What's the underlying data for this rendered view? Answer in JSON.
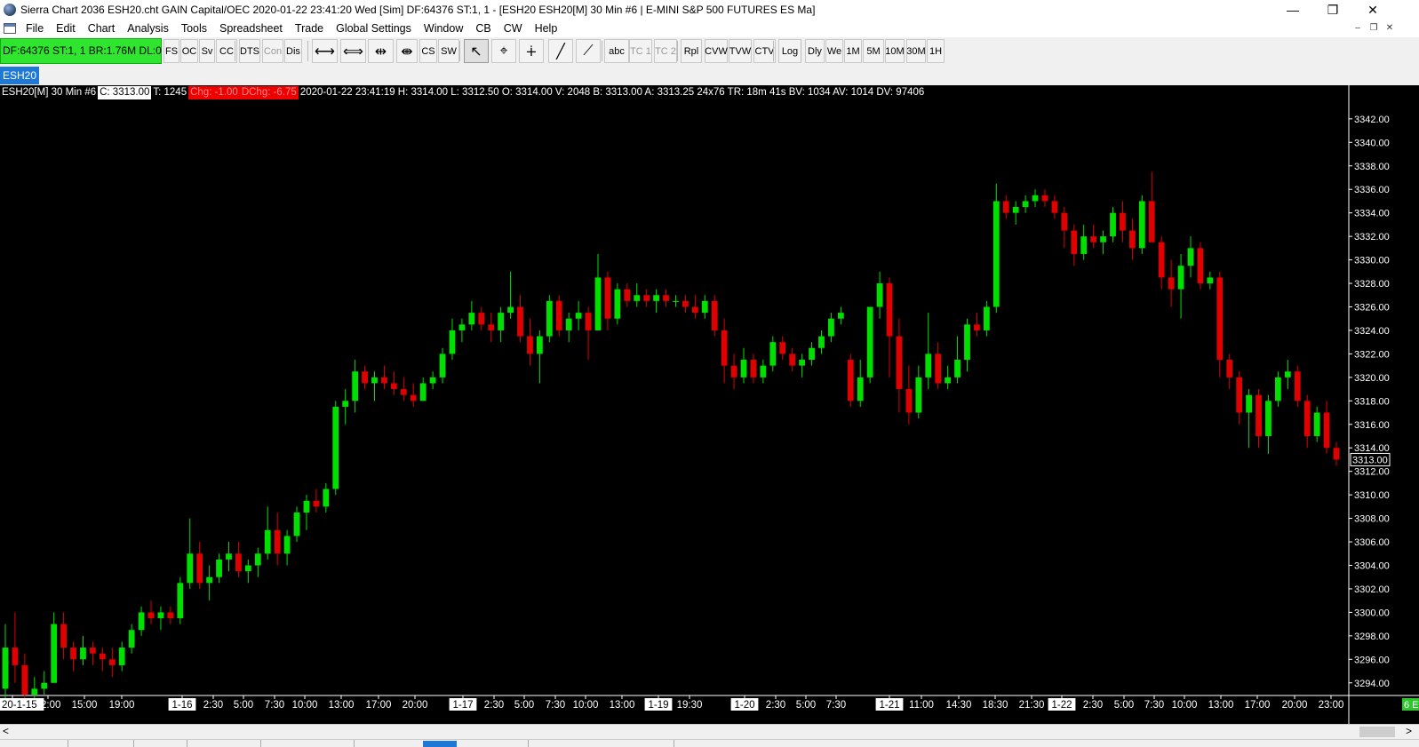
{
  "window": {
    "title": "Sierra Chart 2036 ESH20.cht  GAIN Capital/OEC 2020-01-22  23:41:20 Wed [Sim]  DF:64376  ST:1, 1 - [ESH20  ESH20[M]  30 Min   #6 | E-MINI S&P 500 FUTURES ES Ma]",
    "minimize": "—",
    "maximize": "❐",
    "close": "✕",
    "mdi_minimize": "–",
    "mdi_restore": "❐",
    "mdi_close": "✕"
  },
  "menu": [
    "File",
    "Edit",
    "Chart",
    "Analysis",
    "Tools",
    "Spreadsheet",
    "Trade",
    "Global Settings",
    "Window",
    "CB",
    "CW",
    "Help"
  ],
  "toolbar": {
    "status": "DF:64376  ST:1, 1   BR:1.76M  DL:0",
    "buttons": [
      "FS",
      "OC",
      "Sv",
      "CC",
      "DTS",
      "Con",
      "Dis",
      "⟷",
      "⟺",
      "⇹",
      "⇼",
      "CS",
      "SW",
      "↖",
      "⌖",
      "∔",
      "╱",
      "⟋",
      "abc",
      "TC 1",
      "TC 2",
      "Rpl",
      "CVW",
      "TVW",
      "CTV",
      "Log",
      "Dly",
      "We",
      "1M",
      "5M",
      "10M",
      "30M",
      "1H"
    ],
    "colors": {
      "status_bg": "#2fe52f"
    }
  },
  "tab": {
    "label": "ESH20"
  },
  "chart": {
    "info": {
      "symbol": "ESH20[M]  30 Min   #6",
      "close": "C: 3313.00",
      "trades": "T: 1245",
      "chg": "Chg: -1.00",
      "dchg": "DChg: -6.75",
      "rest": "2020-01-22 23:41:19 H: 3314.00 L: 3312.50 O: 3314.00 V: 2048 B: 3313.00 A: 3313.25 24x76 TR: 18m 41s BV: 1034 AV: 1014 DV: 97406"
    },
    "colors": {
      "up": "#00e000",
      "down": "#e00000",
      "background": "#000000",
      "axis_text": "#ffffff"
    },
    "price_labels": [
      "3342.00",
      "3340.00",
      "3338.00",
      "3336.00",
      "3334.00",
      "3332.00",
      "3330.00",
      "3328.00",
      "3326.00",
      "3324.00",
      "3322.00",
      "3320.00",
      "3318.00",
      "3316.00",
      "3314.00",
      "3312.00",
      "3310.00",
      "3308.00",
      "3306.00",
      "3304.00",
      "3302.00",
      "3300.00",
      "3298.00",
      "3296.00",
      "3294.00"
    ],
    "current_price": "3313.00",
    "corner_badge": "6 E",
    "time_labels": [
      {
        "t": "20-1-15",
        "box": true
      },
      {
        "t": "12:00"
      },
      {
        "t": "15:00"
      },
      {
        "t": "19:00"
      },
      {
        "t": "1-16",
        "box": true
      },
      {
        "t": "2:30"
      },
      {
        "t": "5:00"
      },
      {
        "t": "7:30"
      },
      {
        "t": "10:00"
      },
      {
        "t": "13:00"
      },
      {
        "t": "17:00"
      },
      {
        "t": "20:00"
      },
      {
        "t": "1-17",
        "box": true
      },
      {
        "t": "2:30"
      },
      {
        "t": "5:00"
      },
      {
        "t": "7:30"
      },
      {
        "t": "10:00"
      },
      {
        "t": "13:00"
      },
      {
        "t": "1-19",
        "box": true
      },
      {
        "t": "19:30"
      },
      {
        "t": "1-20",
        "box": true
      },
      {
        "t": "2:30"
      },
      {
        "t": "5:00"
      },
      {
        "t": "7:30"
      },
      {
        "t": "1-21",
        "box": true
      },
      {
        "t": "11:00"
      },
      {
        "t": "14:30"
      },
      {
        "t": "18:30"
      },
      {
        "t": "21:30"
      },
      {
        "t": "1-22",
        "box": true
      },
      {
        "t": "2:30"
      },
      {
        "t": "5:00"
      },
      {
        "t": "7:30"
      },
      {
        "t": "10:00"
      },
      {
        "t": "13:00"
      },
      {
        "t": "17:00"
      },
      {
        "t": "20:00"
      },
      {
        "t": "23:00"
      }
    ],
    "scroll_left": "<",
    "scroll_right": ">"
  },
  "chart_data": {
    "type": "candlestick",
    "ylim": [
      3293,
      3343.5
    ],
    "series": [
      {
        "ohlc": [
          [
            3293.5,
            3299.0,
            3292.5,
            3297.0
          ],
          [
            3297.0,
            3300.0,
            3294.0,
            3295.5
          ],
          [
            3295.5,
            3296.5,
            3292.0,
            3293.0
          ],
          [
            3293.0,
            3294.5,
            3292.0,
            3293.5
          ],
          [
            3293.5,
            3295.0,
            3293.0,
            3294.0
          ],
          [
            3294.0,
            3300.0,
            3294.0,
            3299.0
          ],
          [
            3299.0,
            3300.0,
            3296.0,
            3297.0
          ],
          [
            3297.0,
            3297.5,
            3295.0,
            3296.0
          ],
          [
            3296.0,
            3298.0,
            3295.5,
            3297.0
          ],
          [
            3297.0,
            3297.5,
            3295.5,
            3296.5
          ],
          [
            3296.5,
            3297.0,
            3295.0,
            3296.0
          ],
          [
            3296.0,
            3297.0,
            3294.5,
            3295.5
          ],
          [
            3295.5,
            3297.5,
            3295.0,
            3297.0
          ],
          [
            3297.0,
            3299.0,
            3296.5,
            3298.5
          ],
          [
            3298.5,
            3300.5,
            3298.0,
            3300.0
          ],
          [
            3300.0,
            3301.0,
            3299.0,
            3299.5
          ],
          [
            3299.5,
            3300.5,
            3298.5,
            3300.0
          ],
          [
            3300.0,
            3300.5,
            3299.0,
            3299.5
          ],
          [
            3299.5,
            3303.0,
            3299.0,
            3302.5
          ],
          [
            3302.5,
            3308.0,
            3302.0,
            3305.0
          ],
          [
            3305.0,
            3306.0,
            3302.0,
            3302.5
          ],
          [
            3302.5,
            3304.0,
            3301.0,
            3303.0
          ],
          [
            3303.0,
            3305.0,
            3302.5,
            3304.5
          ],
          [
            3304.5,
            3306.0,
            3303.5,
            3305.0
          ],
          [
            3305.0,
            3306.0,
            3303.0,
            3303.5
          ],
          [
            3303.5,
            3304.5,
            3302.5,
            3304.0
          ],
          [
            3304.0,
            3305.5,
            3303.0,
            3305.0
          ],
          [
            3305.0,
            3309.0,
            3304.5,
            3307.0
          ],
          [
            3307.0,
            3308.5,
            3304.0,
            3305.0
          ],
          [
            3305.0,
            3307.0,
            3304.0,
            3306.5
          ],
          [
            3306.5,
            3309.0,
            3306.0,
            3308.5
          ],
          [
            3308.5,
            3310.0,
            3307.0,
            3309.5
          ],
          [
            3309.5,
            3310.5,
            3308.5,
            3309.0
          ],
          [
            3309.0,
            3311.0,
            3308.5,
            3310.5
          ],
          [
            3310.5,
            3318.0,
            3310.0,
            3317.5
          ],
          [
            3317.5,
            3319.0,
            3316.0,
            3318.0
          ],
          [
            3318.0,
            3321.5,
            3317.0,
            3320.5
          ],
          [
            3320.5,
            3321.0,
            3319.0,
            3319.5
          ],
          [
            3319.5,
            3320.5,
            3318.0,
            3320.0
          ],
          [
            3320.0,
            3321.0,
            3319.0,
            3319.5
          ],
          [
            3319.5,
            3320.5,
            3318.5,
            3319.0
          ],
          [
            3319.0,
            3320.0,
            3318.0,
            3318.5
          ],
          [
            3318.5,
            3319.5,
            3317.5,
            3318.0
          ],
          [
            3318.0,
            3320.0,
            3318.0,
            3319.5
          ],
          [
            3319.5,
            3320.5,
            3319.0,
            3320.0
          ],
          [
            3320.0,
            3322.5,
            3319.5,
            3322.0
          ],
          [
            3322.0,
            3325.0,
            3321.5,
            3324.0
          ],
          [
            3324.0,
            3325.0,
            3323.0,
            3324.5
          ],
          [
            3324.5,
            3326.5,
            3324.0,
            3325.5
          ],
          [
            3325.5,
            3326.0,
            3324.0,
            3324.5
          ],
          [
            3324.5,
            3325.5,
            3323.0,
            3324.0
          ],
          [
            3324.0,
            3326.0,
            3323.0,
            3325.5
          ],
          [
            3325.5,
            3329.0,
            3325.0,
            3326.0
          ],
          [
            3326.0,
            3327.0,
            3323.0,
            3323.5
          ],
          [
            3323.5,
            3325.0,
            3321.0,
            3322.0
          ],
          [
            3322.0,
            3324.0,
            3319.5,
            3323.5
          ],
          [
            3323.5,
            3327.0,
            3323.0,
            3326.5
          ],
          [
            3326.5,
            3327.0,
            3323.5,
            3324.0
          ],
          [
            3324.0,
            3325.5,
            3323.0,
            3325.0
          ],
          [
            3325.0,
            3326.5,
            3324.0,
            3325.5
          ],
          [
            3325.5,
            3326.0,
            3321.5,
            3324.0
          ],
          [
            3324.0,
            3330.5,
            3324.0,
            3328.5
          ],
          [
            3328.5,
            3329.0,
            3324.0,
            3325.0
          ],
          [
            3325.0,
            3328.0,
            3324.5,
            3327.5
          ],
          [
            3327.5,
            3328.0,
            3326.0,
            3326.5
          ],
          [
            3326.5,
            3328.0,
            3326.0,
            3327.0
          ],
          [
            3327.0,
            3327.5,
            3326.0,
            3326.5
          ],
          [
            3326.5,
            3327.5,
            3325.5,
            3327.0
          ],
          [
            3327.0,
            3327.5,
            3326.0,
            3326.5
          ],
          [
            3326.5,
            3327.0,
            3326.0,
            3326.5
          ],
          [
            3326.5,
            3327.0,
            3325.5,
            3326.0
          ],
          [
            3326.0,
            3327.0,
            3325.0,
            3325.5
          ],
          [
            3325.5,
            3327.0,
            3325.0,
            3326.5
          ],
          [
            3326.5,
            3327.0,
            3323.5,
            3324.0
          ],
          [
            3324.0,
            3325.0,
            3319.5,
            3321.0
          ],
          [
            3321.0,
            3322.0,
            3319.0,
            3320.0
          ],
          [
            3320.0,
            3322.5,
            3319.5,
            3321.5
          ],
          [
            3321.5,
            3322.0,
            3319.5,
            3320.0
          ],
          [
            3320.0,
            3321.5,
            3319.5,
            3321.0
          ],
          [
            3321.0,
            3323.5,
            3320.5,
            3323.0
          ],
          [
            3323.0,
            3323.5,
            3321.5,
            3322.0
          ],
          [
            3322.0,
            3322.5,
            3320.5,
            3321.0
          ],
          [
            3321.0,
            3322.0,
            3320.0,
            3321.5
          ],
          [
            3321.5,
            3323.0,
            3321.0,
            3322.5
          ],
          [
            3322.5,
            3324.0,
            3322.0,
            3323.5
          ],
          [
            3323.5,
            3325.5,
            3323.0,
            3325.0
          ],
          [
            3325.0,
            3326.0,
            3324.5,
            3325.5
          ],
          [
            3321.5,
            3322.0,
            3317.5,
            3318.0
          ],
          [
            3318.0,
            3321.5,
            3317.5,
            3320.0
          ],
          [
            3320.0,
            3325.5,
            3319.5,
            3326.0
          ],
          [
            3326.0,
            3329.0,
            3325.0,
            3328.0
          ],
          [
            3328.0,
            3328.5,
            3320.0,
            3323.5
          ],
          [
            3323.5,
            3325.0,
            3317.0,
            3319.0
          ],
          [
            3319.0,
            3321.0,
            3316.0,
            3317.0
          ],
          [
            3317.0,
            3321.0,
            3316.5,
            3320.0
          ],
          [
            3320.0,
            3325.5,
            3319.0,
            3322.0
          ],
          [
            3322.0,
            3323.0,
            3319.0,
            3319.5
          ],
          [
            3319.5,
            3321.0,
            3319.0,
            3320.0
          ],
          [
            3320.0,
            3323.5,
            3319.5,
            3321.5
          ],
          [
            3321.5,
            3325.0,
            3320.5,
            3324.5
          ],
          [
            3324.5,
            3325.5,
            3323.5,
            3324.0
          ],
          [
            3324.0,
            3326.5,
            3323.5,
            3326.0
          ],
          [
            3326.0,
            3336.5,
            3325.5,
            3335.0
          ],
          [
            3335.0,
            3335.5,
            3333.5,
            3334.0
          ],
          [
            3334.0,
            3335.0,
            3333.0,
            3334.5
          ],
          [
            3334.5,
            3335.5,
            3334.0,
            3335.0
          ],
          [
            3335.0,
            3336.0,
            3334.5,
            3335.5
          ],
          [
            3335.5,
            3336.0,
            3334.5,
            3335.0
          ],
          [
            3335.0,
            3335.5,
            3333.5,
            3334.0
          ],
          [
            3334.0,
            3334.5,
            3331.0,
            3332.5
          ],
          [
            3332.5,
            3333.0,
            3329.5,
            3330.5
          ],
          [
            3330.5,
            3333.0,
            3330.0,
            3332.0
          ],
          [
            3332.0,
            3333.0,
            3331.0,
            3331.5
          ],
          [
            3331.5,
            3332.5,
            3330.5,
            3332.0
          ],
          [
            3332.0,
            3334.5,
            3331.5,
            3334.0
          ],
          [
            3334.0,
            3335.0,
            3331.5,
            3332.5
          ],
          [
            3332.5,
            3333.5,
            3330.0,
            3331.0
          ],
          [
            3331.0,
            3335.5,
            3330.5,
            3335.0
          ],
          [
            3335.0,
            3337.5,
            3333.0,
            3331.5
          ],
          [
            3331.5,
            3332.0,
            3327.5,
            3328.5
          ],
          [
            3328.5,
            3330.0,
            3326.0,
            3327.5
          ],
          [
            3327.5,
            3330.5,
            3325.0,
            3329.5
          ],
          [
            3329.5,
            3332.0,
            3328.5,
            3331.0
          ],
          [
            3331.0,
            3331.5,
            3327.5,
            3328.0
          ],
          [
            3328.0,
            3329.0,
            3327.5,
            3328.5
          ],
          [
            3328.5,
            3329.0,
            3320.0,
            3321.5
          ],
          [
            3321.5,
            3322.0,
            3319.0,
            3320.0
          ],
          [
            3320.0,
            3320.5,
            3316.0,
            3317.0
          ],
          [
            3317.0,
            3319.0,
            3314.0,
            3318.5
          ],
          [
            3318.5,
            3319.0,
            3314.0,
            3315.0
          ],
          [
            3315.0,
            3318.5,
            3313.5,
            3318.0
          ],
          [
            3318.0,
            3320.5,
            3317.5,
            3320.0
          ],
          [
            3320.0,
            3321.5,
            3319.0,
            3320.5
          ],
          [
            3320.5,
            3321.0,
            3317.5,
            3318.0
          ],
          [
            3318.0,
            3318.5,
            3314.0,
            3315.0
          ],
          [
            3315.0,
            3317.5,
            3314.5,
            3317.0
          ],
          [
            3317.0,
            3318.0,
            3313.5,
            3314.0
          ],
          [
            3314.0,
            3314.5,
            3312.5,
            3313.0
          ]
        ]
      }
    ],
    "current_price": 3313.0
  }
}
